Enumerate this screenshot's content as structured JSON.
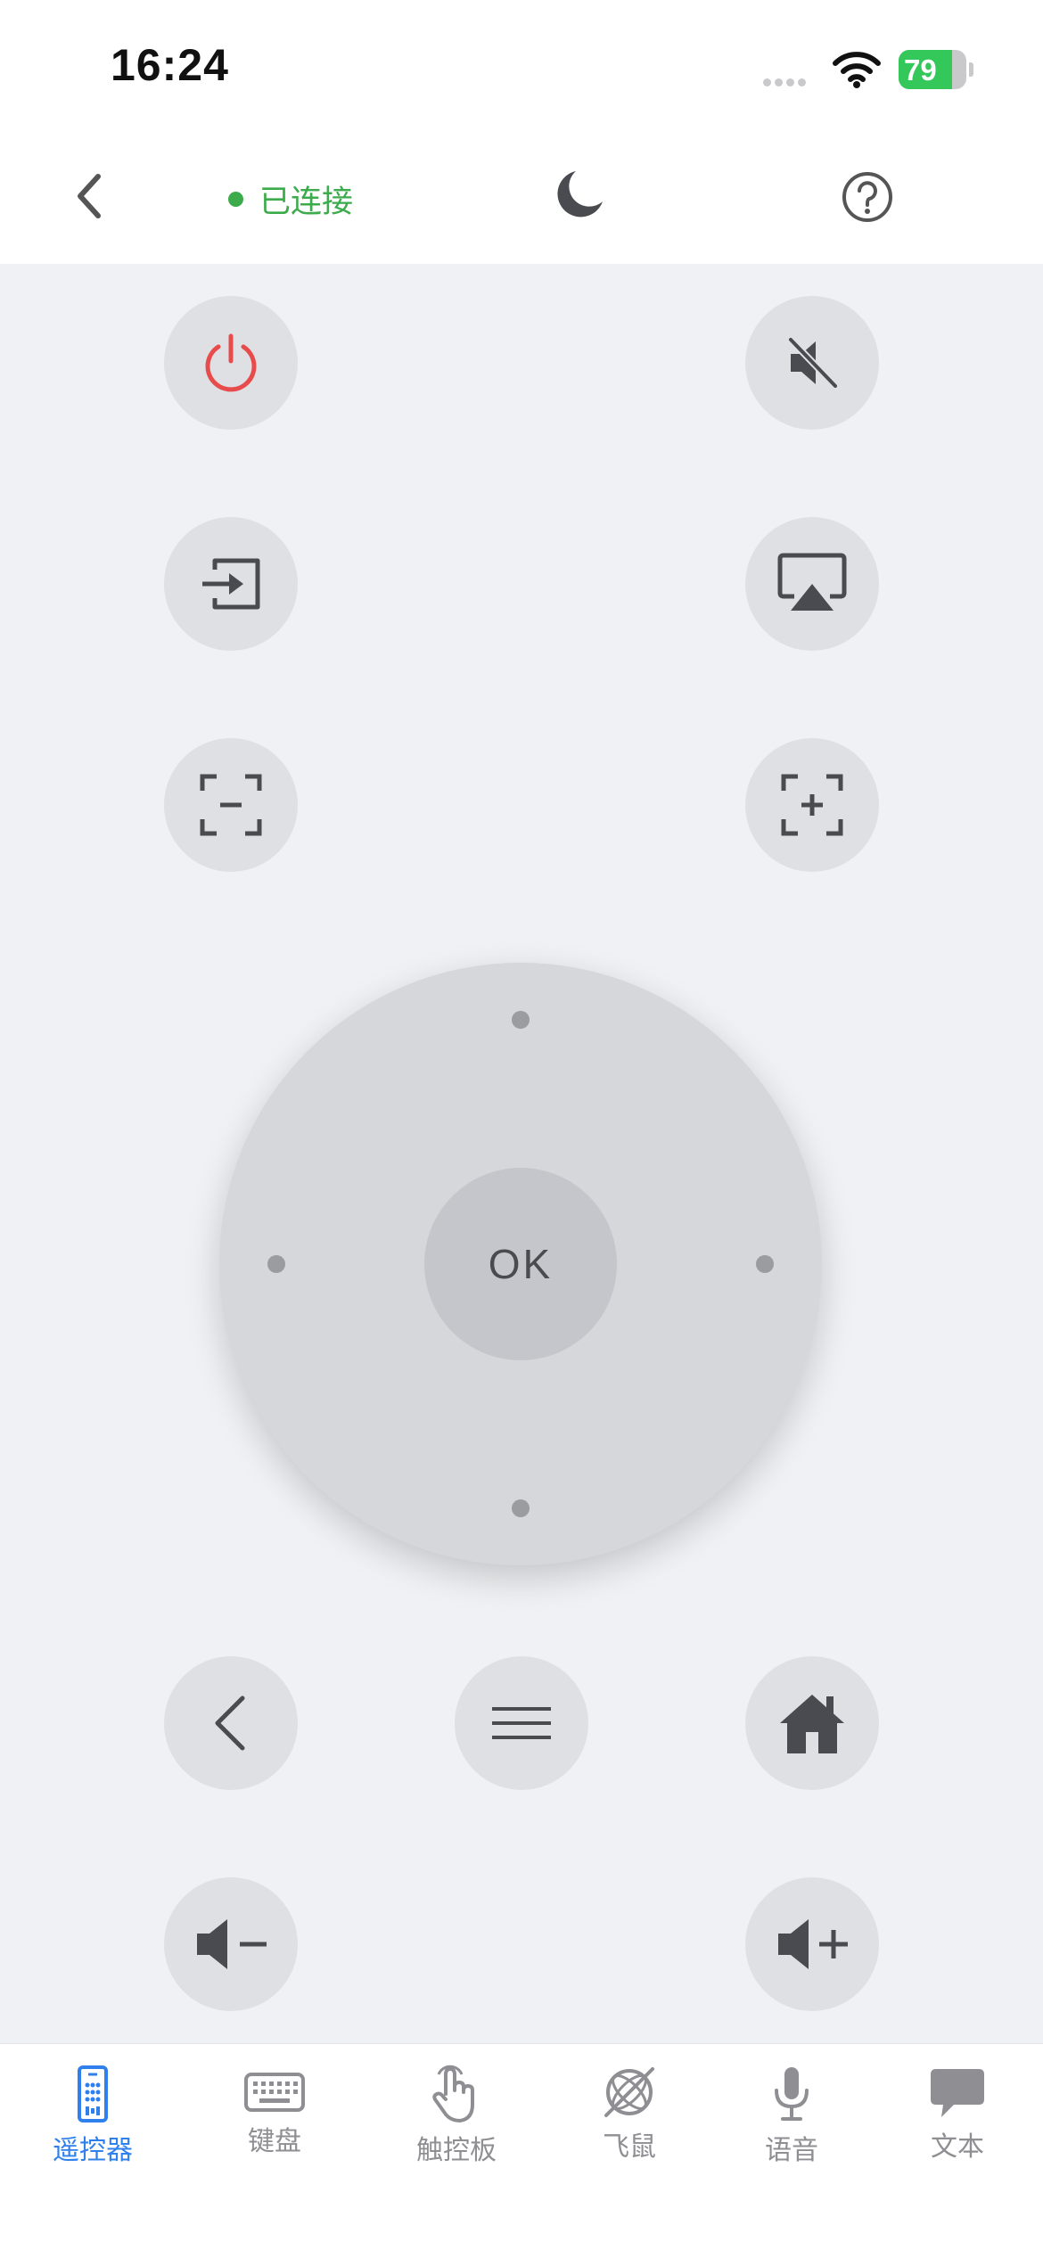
{
  "status_bar": {
    "time": "16:24",
    "battery": 79
  },
  "nav": {
    "connection_status": "已连接"
  },
  "dpad": {
    "ok_label": "OK"
  },
  "tabs": [
    {
      "label": "遥控器",
      "icon": "remote-icon",
      "active": true
    },
    {
      "label": "键盘",
      "icon": "keyboard-icon",
      "active": false
    },
    {
      "label": "触控板",
      "icon": "touchpad-hand-icon",
      "active": false
    },
    {
      "label": "飞鼠",
      "icon": "air-mouse-icon",
      "active": false
    },
    {
      "label": "语音",
      "icon": "microphone-icon",
      "active": false
    },
    {
      "label": "文本",
      "icon": "chat-bubble-icon",
      "active": false
    }
  ],
  "colors": {
    "accent": "#2f80ed",
    "connected": "#3cab4b",
    "power": "#e84b4b",
    "battery": "#34c759",
    "background": "#f0f1f4",
    "button": "#dfe0e4"
  }
}
